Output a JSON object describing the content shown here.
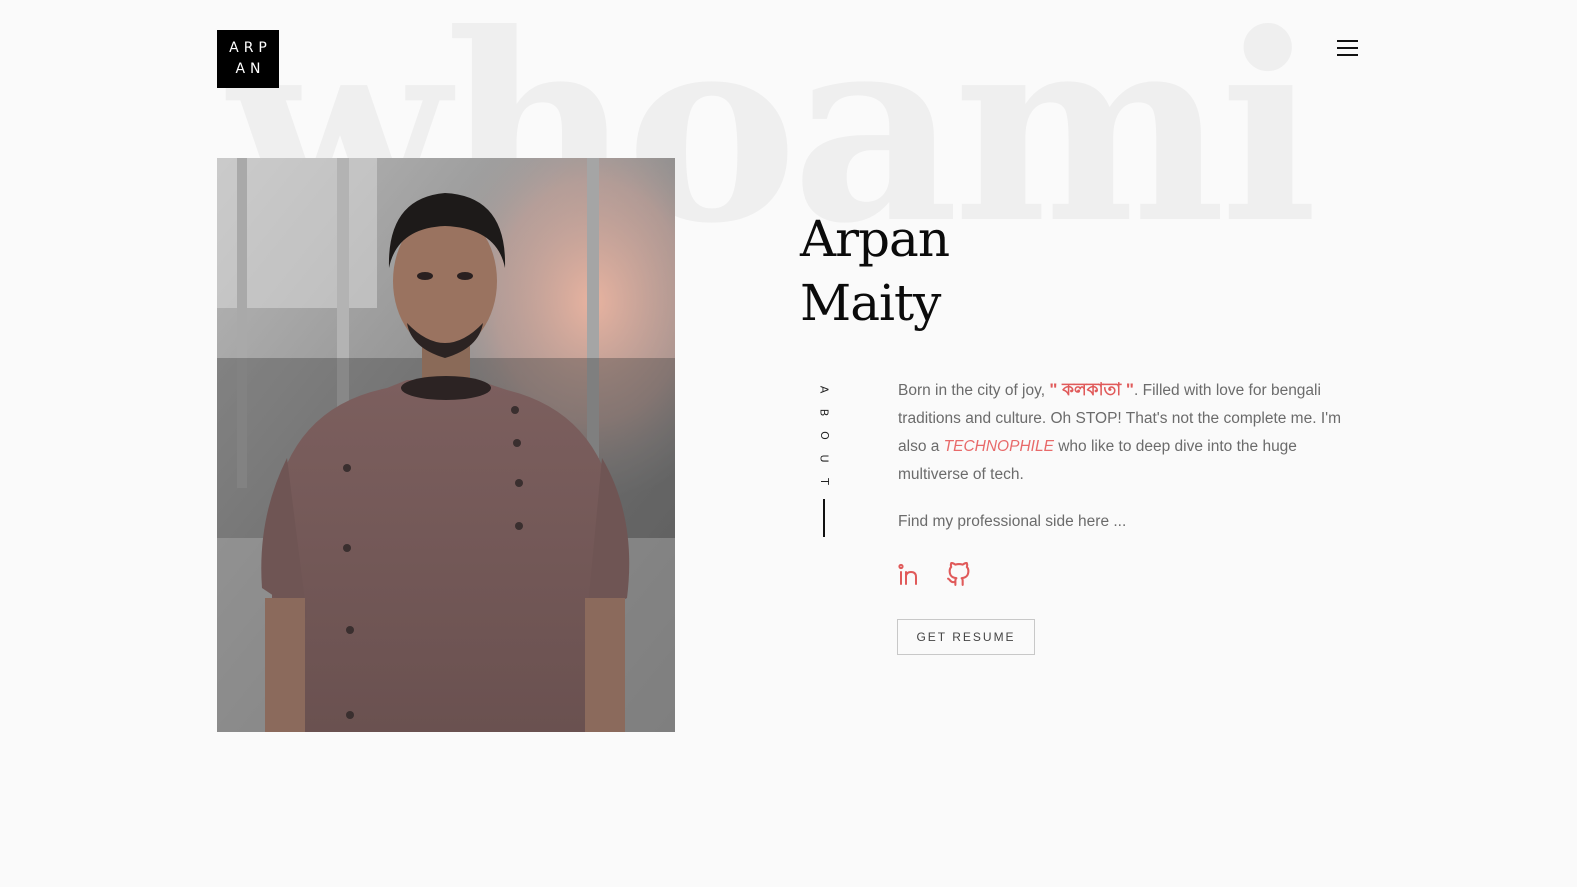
{
  "background_word": "whoami",
  "logo": {
    "line1": "ARP",
    "line2": "AN"
  },
  "menu": {
    "icon": "hamburger-menu-icon"
  },
  "portrait": {
    "subject": "Arpan Maity"
  },
  "hero": {
    "first_name": "Arpan",
    "last_name": "Maity"
  },
  "about": {
    "label": [
      "A",
      "B",
      "O",
      "U",
      "T"
    ],
    "bio_part1": "Born in the city of joy, ",
    "city": "\" কলকাতা \"",
    "bio_part2": ". Filled with love for bengali traditions and culture. Oh STOP! That's not the complete me. I'm also a ",
    "highlight": "TECHNOPHILE",
    "bio_part3": " who like to deep dive into the huge multiverse of tech.",
    "find_text": "Find my professional side here ..."
  },
  "socials": [
    {
      "name": "LinkedIn",
      "icon": "linkedin-icon"
    },
    {
      "name": "GitHub",
      "icon": "github-icon"
    }
  ],
  "resume_button": "GET RESUME",
  "colors": {
    "accent": "#e05a5a",
    "background": "#fafafa",
    "logo_bg": "#000000"
  }
}
